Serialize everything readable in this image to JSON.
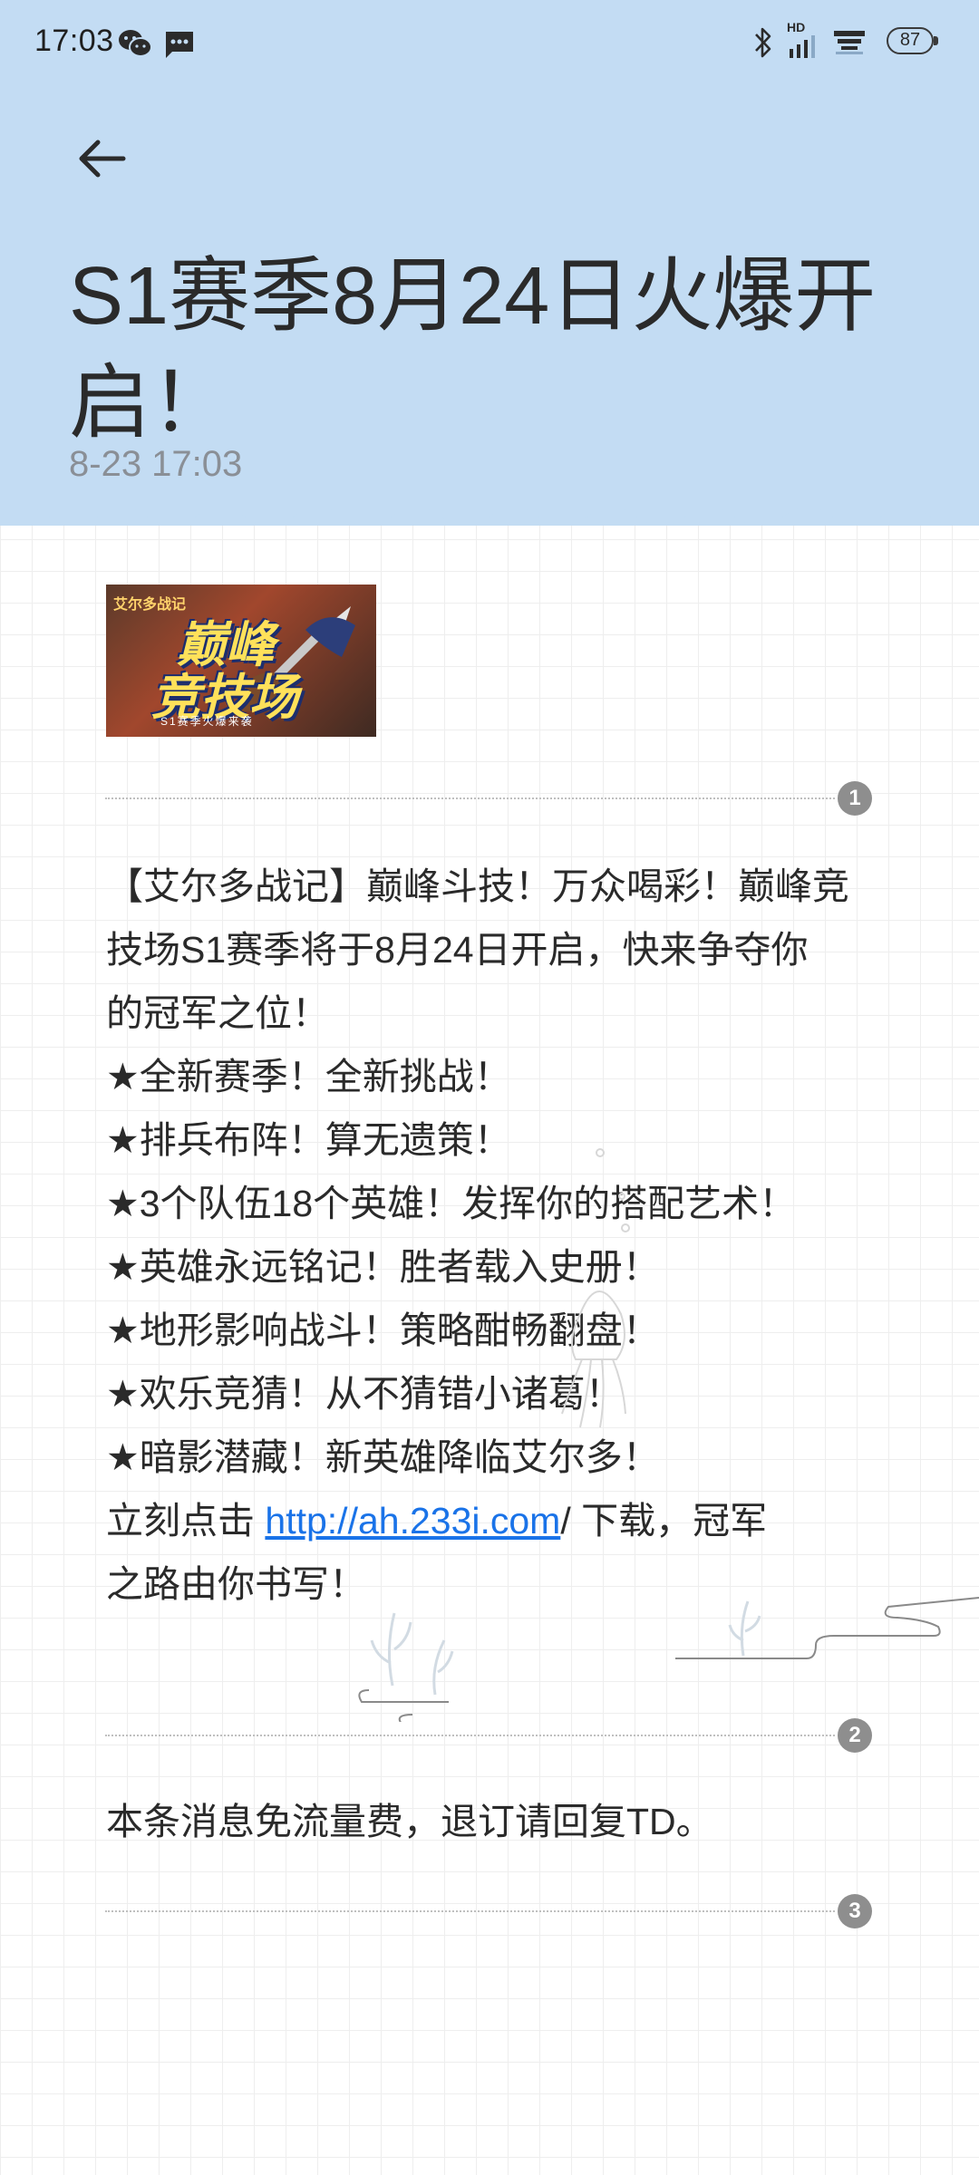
{
  "status_bar": {
    "time": "17:03",
    "icons": [
      "wechat-icon",
      "message-icon",
      "bluetooth-icon",
      "hd-signal-icon",
      "wifi-icon"
    ],
    "hd_label": "HD",
    "battery": "87"
  },
  "header": {
    "background_color": "#c3dcf3",
    "title_line1": "S1赛季8月24日火爆开",
    "title_line2": "启！",
    "date": "8-23 17:03"
  },
  "banner": {
    "logo_small": "艾尔多战记",
    "title_line1": "巅峰",
    "title_line2": "竞技场",
    "subtitle": "S1赛季火爆来袭"
  },
  "sections": [
    {
      "badge": "1"
    },
    {
      "badge": "2"
    },
    {
      "badge": "3"
    }
  ],
  "message": {
    "lines": [
      "【艾尔多战记】巅峰斗技！万众喝彩！巅峰竞",
      "技场S1赛季将于8月24日开启，快来争夺你",
      "的冠军之位！",
      "★全新赛季！全新挑战！",
      "★排兵布阵！算无遗策！",
      "★3个队伍18个英雄！发挥你的搭配艺术！",
      "★英雄永远铭记！胜者载入史册！",
      "★地形影响战斗！策略酣畅翻盘！",
      "★欢乐竞猜！从不猜错小诸葛！",
      "★暗影潜藏！新英雄降临艾尔多！"
    ],
    "link_prefix": "立刻点击 ",
    "link_text": "http://ah.233i.com",
    "link_suffix": "/ 下载，冠军",
    "last_line": "之路由你书写！",
    "link_color": "#1a73e8"
  },
  "footer_note": "本条消息免流量费，退订请回复TD。"
}
